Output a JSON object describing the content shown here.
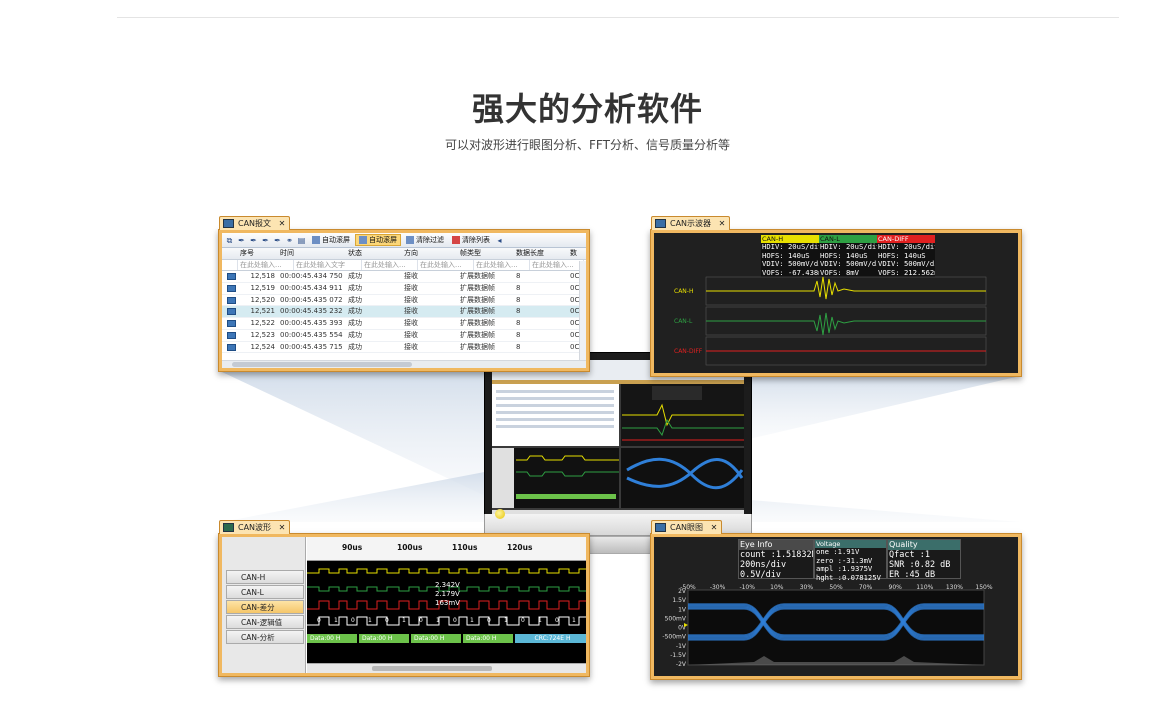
{
  "header": {
    "title": "强大的分析软件",
    "subtitle": "可以对波形进行眼图分析、FFT分析、信号质量分析等"
  },
  "can_message_panel": {
    "tab_label": "CAN报文",
    "toolbar": {
      "auto_scroll": "自动滚屏",
      "auto_ring": "自动滚屏",
      "clear_filter": "清除过滤",
      "clear_list": "清除列表"
    },
    "columns": [
      "序号",
      "时间",
      "状态",
      "方向",
      "帧类型",
      "数据长度",
      "数"
    ],
    "filters": [
      "在此处输入...",
      "在此处输入文字",
      "在此处输入...",
      "在此处输入...",
      "在此处输入...",
      "在此处输入...",
      ""
    ],
    "rows": [
      {
        "no": "12,518",
        "time": "00:00:45.434 750",
        "status": "成功",
        "dir": "接收",
        "type": "扩展数据帧",
        "len": "8",
        "data": "0C"
      },
      {
        "no": "12,519",
        "time": "00:00:45.434 911",
        "status": "成功",
        "dir": "接收",
        "type": "扩展数据帧",
        "len": "8",
        "data": "0C"
      },
      {
        "no": "12,520",
        "time": "00:00:45.435 072",
        "status": "成功",
        "dir": "接收",
        "type": "扩展数据帧",
        "len": "8",
        "data": "0C"
      },
      {
        "no": "12,521",
        "time": "00:00:45.435 232",
        "status": "成功",
        "dir": "接收",
        "type": "扩展数据帧",
        "len": "8",
        "data": "0C"
      },
      {
        "no": "12,522",
        "time": "00:00:45.435 393",
        "status": "成功",
        "dir": "接收",
        "type": "扩展数据帧",
        "len": "8",
        "data": "0C"
      },
      {
        "no": "12,523",
        "time": "00:00:45.435 554",
        "status": "成功",
        "dir": "接收",
        "type": "扩展数据帧",
        "len": "8",
        "data": "0C"
      },
      {
        "no": "12,524",
        "time": "00:00:45.435 715",
        "status": "成功",
        "dir": "接收",
        "type": "扩展数据帧",
        "len": "8",
        "data": "0C"
      }
    ],
    "selected_row_index": 3
  },
  "scope_panel": {
    "tab_label": "CAN示波器",
    "channels": [
      {
        "name": "CAN-H",
        "color": "#e8e000",
        "lines": [
          "HDIV: 20uS/div",
          "HOFS: 140uS",
          "VDIV: 500mV/div",
          "VOFS: -67.438m"
        ]
      },
      {
        "name": "CAN-L",
        "color": "#2ea043",
        "lines": [
          "HDIV: 20uS/div",
          "HOFS: 140uS",
          "VDIV: 500mV/div",
          "VOFS: 8mV"
        ]
      },
      {
        "name": "CAN-DIFF",
        "color": "#e02020",
        "lines": [
          "HDIV: 20uS/div",
          "HOFS: 140uS",
          "VDIV: 500mV/div",
          "VOFS: 212.562m"
        ]
      }
    ],
    "trace_labels": [
      "CAN-H",
      "CAN-L",
      "CAN-DIFF"
    ]
  },
  "wave_panel": {
    "tab_label": "CAN波形",
    "side_items": [
      "CAN-H",
      "CAN-L",
      "CAN-差分",
      "CAN-逻辑值",
      "CAN-分析"
    ],
    "selected_side_index": 2,
    "ruler_labels": [
      "90us",
      "100us",
      "110us",
      "120us"
    ],
    "measure_labels": [
      "2.342V",
      "2.179V",
      "163mV"
    ],
    "logic_bits": [
      "0",
      "1",
      "0",
      "1",
      "0",
      "1",
      "0",
      "1",
      "0",
      "1",
      "0",
      "1",
      "0",
      "1",
      "0",
      "1"
    ],
    "segments": [
      "Data:00 H",
      "Data:00 H",
      "Data:00 H",
      "Data:00 H",
      "CRC:724E H"
    ]
  },
  "eye_panel": {
    "tab_label": "CAN眼图",
    "eye_info": {
      "title": "Eye Info",
      "lines": [
        "count  :1.51832M",
        "200ns/div",
        "0.5V/div"
      ]
    },
    "voltage": {
      "title": "Voltage",
      "lines": [
        "one    :1.91V",
        "zero   :-31.3mV",
        "ampl   :1.9375V",
        "hght   :0.078125V"
      ]
    },
    "quality": {
      "title": "Quality",
      "lines": [
        "Qfact  :1",
        "SNR    :0.82 dB",
        "ER     :45 dB"
      ]
    },
    "x_ticks": [
      "-50%",
      "-30%",
      "-10%",
      "10%",
      "30%",
      "50%",
      "70%",
      "90%",
      "110%",
      "130%",
      "150%"
    ],
    "y_ticks": [
      "2V",
      "1.5V",
      "1V",
      "500mV",
      "0V",
      "-500mV",
      "-1V",
      "-1.5V",
      "-2V"
    ]
  },
  "colors": {
    "panel_frame": "#f0b860",
    "can_h": "#e8e000",
    "can_l": "#2ea043",
    "can_diff": "#e02020",
    "segment_green": "#6cc24a",
    "segment_cyan": "#5bb7d6",
    "eye_blue": "#2f7fd8"
  }
}
